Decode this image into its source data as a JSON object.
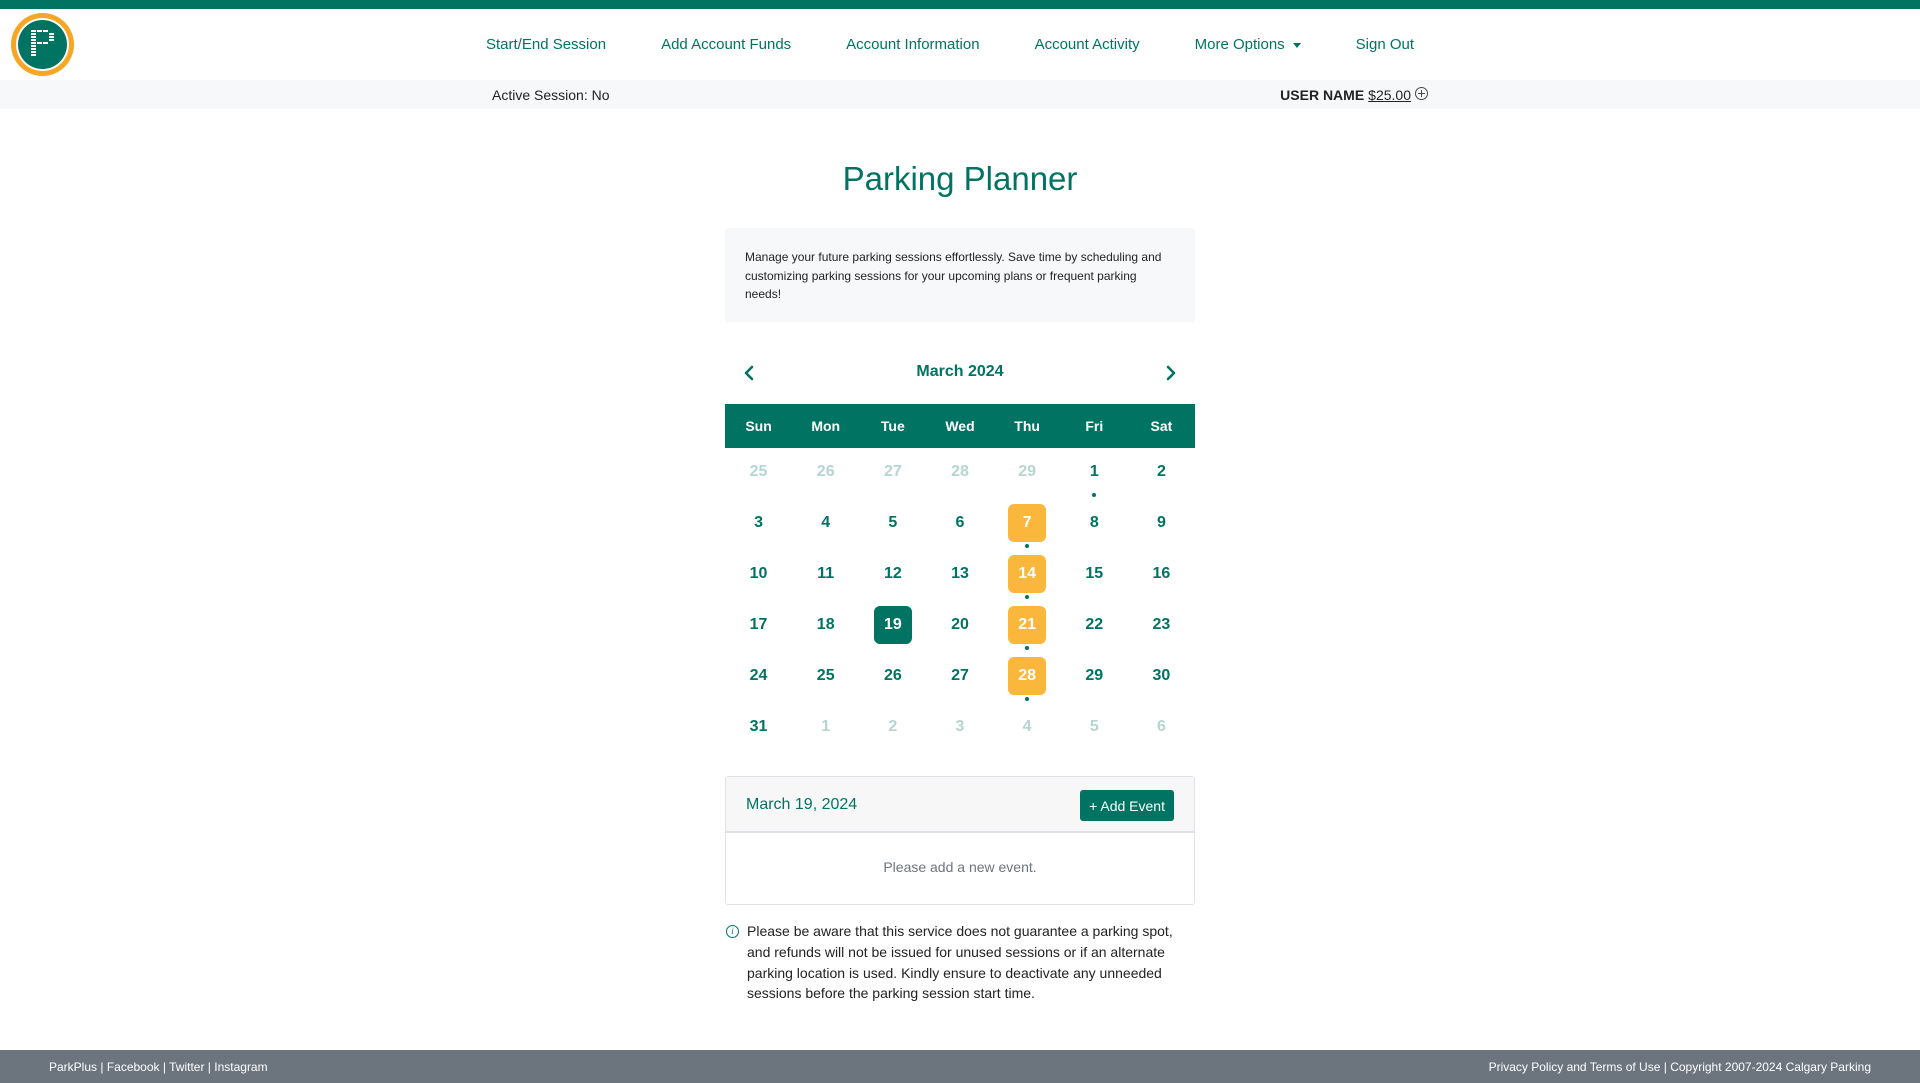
{
  "nav": {
    "logo_icon": "parking-p-logo",
    "links": [
      {
        "label": "Start/End Session"
      },
      {
        "label": "Add Account Funds"
      },
      {
        "label": "Account Information"
      },
      {
        "label": "Account Activity"
      },
      {
        "label": "More Options",
        "has_dropdown": true
      },
      {
        "label": "Sign Out"
      }
    ]
  },
  "subbar": {
    "active_session": "Active Session: No",
    "user_name": "USER NAME",
    "balance": "$25.00",
    "add_funds_icon": "plus-circle-icon"
  },
  "page": {
    "title": "Parking Planner",
    "description": "Manage your future parking sessions effortlessly. Save time by scheduling and customizing parking sessions for your upcoming plans or frequent parking needs!"
  },
  "calendar": {
    "month_label": "March 2024",
    "prev_icon": "chevron-left-icon",
    "next_icon": "chevron-right-icon",
    "weekdays": [
      "Sun",
      "Mon",
      "Tue",
      "Wed",
      "Thu",
      "Fri",
      "Sat"
    ],
    "selected_day": 19,
    "days": [
      {
        "d": "25",
        "other": true
      },
      {
        "d": "26",
        "other": true
      },
      {
        "d": "27",
        "other": true
      },
      {
        "d": "28",
        "other": true
      },
      {
        "d": "29",
        "other": true
      },
      {
        "d": "1",
        "dot": true
      },
      {
        "d": "2"
      },
      {
        "d": "3"
      },
      {
        "d": "4"
      },
      {
        "d": "5"
      },
      {
        "d": "6"
      },
      {
        "d": "7",
        "planned": true,
        "dot": true
      },
      {
        "d": "8"
      },
      {
        "d": "9"
      },
      {
        "d": "10"
      },
      {
        "d": "11"
      },
      {
        "d": "12"
      },
      {
        "d": "13"
      },
      {
        "d": "14",
        "planned": true,
        "dot": true
      },
      {
        "d": "15"
      },
      {
        "d": "16"
      },
      {
        "d": "17"
      },
      {
        "d": "18"
      },
      {
        "d": "19",
        "selected": true
      },
      {
        "d": "20"
      },
      {
        "d": "21",
        "planned": true,
        "dot": true
      },
      {
        "d": "22"
      },
      {
        "d": "23"
      },
      {
        "d": "24"
      },
      {
        "d": "25"
      },
      {
        "d": "26"
      },
      {
        "d": "27"
      },
      {
        "d": "28",
        "planned": true,
        "dot": true
      },
      {
        "d": "29"
      },
      {
        "d": "30"
      },
      {
        "d": "31"
      },
      {
        "d": "1",
        "other": true
      },
      {
        "d": "2",
        "other": true
      },
      {
        "d": "3",
        "other": true
      },
      {
        "d": "4",
        "other": true
      },
      {
        "d": "5",
        "other": true
      },
      {
        "d": "6",
        "other": true
      }
    ]
  },
  "events": {
    "date_label": "March 19, 2024",
    "add_button": "+ Add Event",
    "empty_message": "Please add a new event."
  },
  "notice": {
    "icon": "info-icon",
    "text": "Please be aware that this service does not guarantee a parking spot, and refunds will not be issued for unused sessions or if an alternate parking location is used. Kindly ensure to deactivate any unneeded sessions before the parking session start time."
  },
  "footer": {
    "left_links": [
      "ParkPlus",
      "Facebook",
      "Twitter",
      "Instagram"
    ],
    "separator": " | ",
    "privacy": "Privacy Policy and Terms of Use",
    "copyright": "Copyright  2007-2024 Calgary Parking"
  },
  "colors": {
    "brand": "#007363",
    "accent_planned": "#fbb63c",
    "logo_ring": "#f5a623",
    "muted_day": "#b5d6d0",
    "footer_bg": "#6c757d"
  }
}
